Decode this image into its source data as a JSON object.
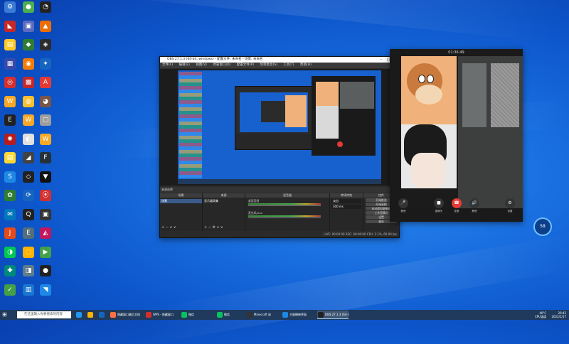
{
  "desktop": {
    "icons": [
      {
        "label": "",
        "color": "#3a7bd5",
        "glyph": "⚙"
      },
      {
        "label": "",
        "color": "#4caf50",
        "glyph": "●"
      },
      {
        "label": "",
        "color": "#222",
        "glyph": "◔"
      },
      {
        "label": "",
        "color": "#c62828",
        "glyph": "◣"
      },
      {
        "label": "",
        "color": "#5c6bc0",
        "glyph": "▣"
      },
      {
        "label": "",
        "color": "#ef6c00",
        "glyph": "▲"
      },
      {
        "label": "",
        "color": "#ffca28",
        "glyph": "▤"
      },
      {
        "label": "",
        "color": "#2e7d32",
        "glyph": "◆"
      },
      {
        "label": "",
        "color": "#2c2c2c",
        "glyph": "◈"
      },
      {
        "label": "",
        "color": "#3949ab",
        "glyph": "▦"
      },
      {
        "label": "",
        "color": "#f57c00",
        "glyph": "◉"
      },
      {
        "label": "",
        "color": "#1565c0",
        "glyph": "✦"
      },
      {
        "label": "",
        "color": "#d32f2f",
        "glyph": "◎"
      },
      {
        "label": "",
        "color": "#c62828",
        "glyph": "▩"
      },
      {
        "label": "",
        "color": "#e53935",
        "glyph": "A"
      },
      {
        "label": "",
        "color": "#f9a825",
        "glyph": "W"
      },
      {
        "label": "",
        "color": "#fbc02d",
        "glyph": "◍"
      },
      {
        "label": "",
        "color": "#795548",
        "glyph": "◕"
      },
      {
        "label": "",
        "color": "#212121",
        "glyph": "E"
      },
      {
        "label": "",
        "color": "#f9a825",
        "glyph": "W"
      },
      {
        "label": "",
        "color": "#9e9e9e",
        "glyph": "▢"
      },
      {
        "label": "",
        "color": "#b71c1c",
        "glyph": "✺"
      },
      {
        "label": "",
        "color": "#e0e0e0",
        "glyph": "◐"
      },
      {
        "label": "",
        "color": "#f9a825",
        "glyph": "W"
      },
      {
        "label": "",
        "color": "#fdd835",
        "glyph": "▤"
      },
      {
        "label": "",
        "color": "#424242",
        "glyph": "◢"
      },
      {
        "label": "",
        "color": "#263238",
        "glyph": "F"
      },
      {
        "label": "",
        "color": "#1e88e5",
        "glyph": "S"
      },
      {
        "label": "",
        "color": "#212121",
        "glyph": "◇"
      },
      {
        "label": "",
        "color": "#111",
        "glyph": "▼"
      },
      {
        "label": "",
        "color": "#2e7d32",
        "glyph": "✿"
      },
      {
        "label": "",
        "color": "#1565c0",
        "glyph": "⟳"
      },
      {
        "label": "",
        "color": "#d32f2f",
        "glyph": "⦿"
      },
      {
        "label": "",
        "color": "#0277bd",
        "glyph": "✉"
      },
      {
        "label": "",
        "color": "#212121",
        "glyph": "Q"
      },
      {
        "label": "",
        "color": "#333",
        "glyph": "▣"
      },
      {
        "label": "",
        "color": "#e64a19",
        "glyph": "J"
      },
      {
        "label": "",
        "color": "#546e7a",
        "glyph": "E"
      },
      {
        "label": "",
        "color": "#c2185b",
        "glyph": "◭"
      },
      {
        "label": "",
        "color": "#00c853",
        "glyph": "◑"
      },
      {
        "label": "",
        "color": "#ffb300",
        "glyph": "◌"
      },
      {
        "label": "",
        "color": "#43a047",
        "glyph": "▶"
      },
      {
        "label": "",
        "color": "#00897b",
        "glyph": "✚"
      },
      {
        "label": "",
        "color": "#607d8b",
        "glyph": "◨"
      },
      {
        "label": "",
        "color": "#212121",
        "glyph": "●"
      },
      {
        "label": "",
        "color": "#43a047",
        "glyph": "✓"
      },
      {
        "label": "",
        "color": "#1976d2",
        "glyph": "▥"
      },
      {
        "label": "",
        "color": "#1e88e5",
        "glyph": "◥"
      }
    ]
  },
  "obs": {
    "title": "OBS 27.1.3 (64-bit, windows) - 配置文件: 未命名 - 场景: 未命名",
    "menu": [
      "文件(F)",
      "编辑(E)",
      "视图(V)",
      "停靠窗口(D)",
      "配置文件(P)",
      "场景集合(S)",
      "工具(T)",
      "帮助(H)"
    ],
    "scenebar": "来源选择",
    "docks": {
      "scenes": "场景",
      "sources": "来源",
      "mixer": "混音器",
      "transitions": "转场特效",
      "controls": "控件"
    },
    "scene_item": "场景",
    "source_item": "显示器采集",
    "mixer_channels": [
      "桌面音频",
      "麦克风/Aux"
    ],
    "transition_value": "淡出",
    "duration_value": "300 ms",
    "control_buttons": [
      "开始推流",
      "开始录制",
      "启动虚拟摄像机",
      "工作室模式",
      "设置",
      "退出"
    ],
    "status": "LIVE: 00:00:00   REC: 00:00:00   CPU: 2.1%, 60.00 fps"
  },
  "call": {
    "time": "01:36:49",
    "buttons": [
      "静音",
      "摄像头",
      "挂断",
      "静音",
      "设置"
    ]
  },
  "widget": {
    "value": "58"
  },
  "taskbar": {
    "search_placeholder": "在这里输入你要搜索的内容",
    "items": [
      {
        "label": "",
        "color": "#2196f3"
      },
      {
        "label": "",
        "color": "#ffb300"
      },
      {
        "label": "",
        "color": "#1565c0"
      },
      {
        "label": "隐藏窗口最后文档",
        "color": "#ff7043"
      },
      {
        "label": "WPS - 隐藏窗口",
        "color": "#d32f2f"
      },
      {
        "label": "微信",
        "color": "#07c160"
      },
      {
        "label": "微信",
        "color": "#07c160"
      },
      {
        "label": "Minecraft 启",
        "color": "#333"
      },
      {
        "label": "主窗播映界面",
        "color": "#1e88e5"
      },
      {
        "label": "OBS 27.1.3 (64-bi...",
        "color": "#222"
      }
    ],
    "tray": {
      "time": "20:42",
      "date": "2022/1/17",
      "weather": "40°C",
      "weather_sub": "CPU温度"
    }
  }
}
